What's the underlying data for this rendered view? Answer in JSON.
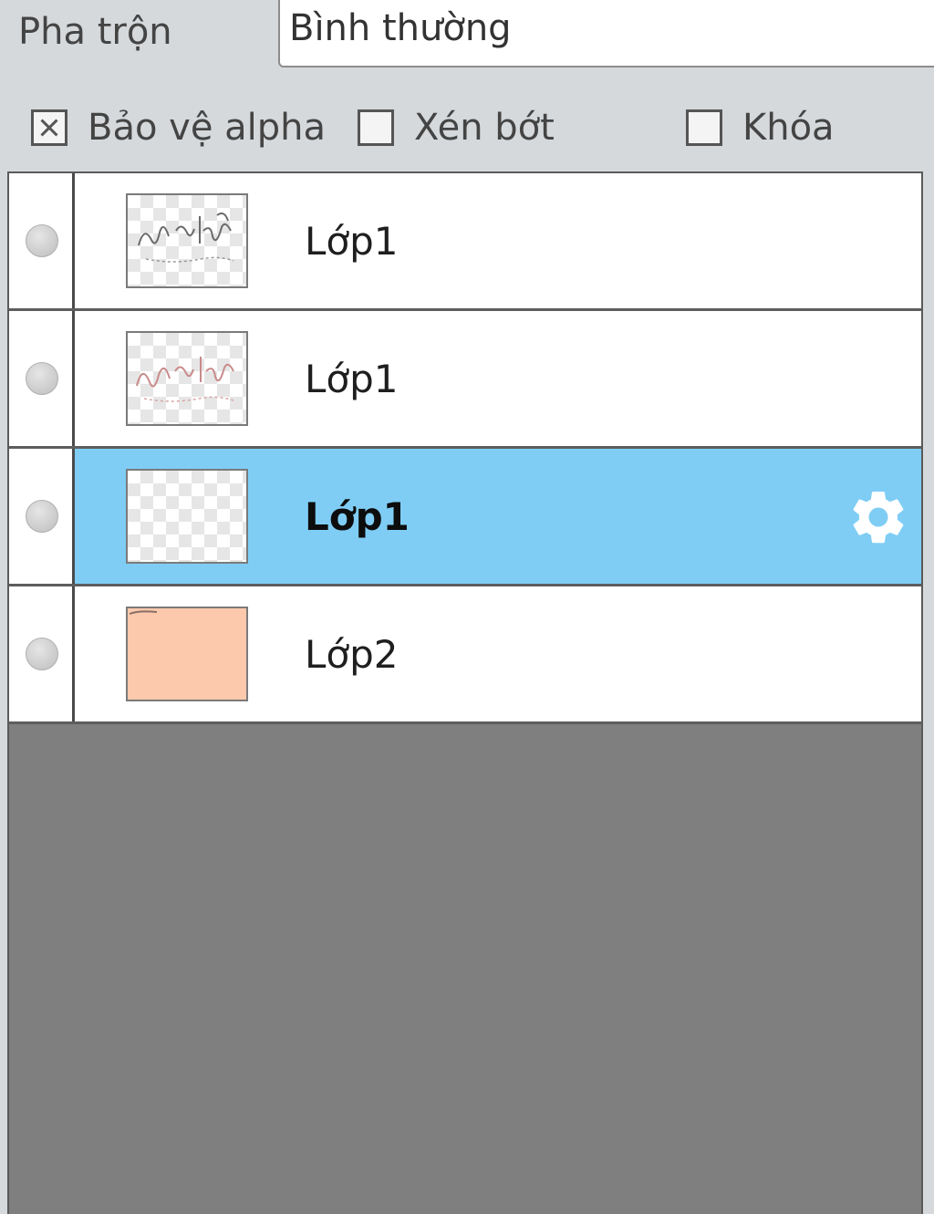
{
  "blend": {
    "label": "Pha trộn",
    "value": "Bình thường"
  },
  "options": [
    {
      "label": "Bảo vệ alpha",
      "checked": true
    },
    {
      "label": "Xén bớt",
      "checked": false
    },
    {
      "label": "Khóa",
      "checked": false
    }
  ],
  "layers": [
    {
      "name": "Lớp1",
      "selected": false,
      "thumb": "checker-gray-sketch"
    },
    {
      "name": "Lớp1",
      "selected": false,
      "thumb": "checker-red-sketch"
    },
    {
      "name": "Lớp1",
      "selected": true,
      "thumb": "checker-empty"
    },
    {
      "name": "Lớp2",
      "selected": false,
      "thumb": "solid-peach"
    }
  ],
  "colors": {
    "selected_row": "#7fcdf5",
    "peach_fill": "#fdc9ad",
    "empty_area": "#7f7f7f"
  },
  "icons": {
    "visibility": "visibility-dot-icon",
    "settings": "gear-icon"
  }
}
